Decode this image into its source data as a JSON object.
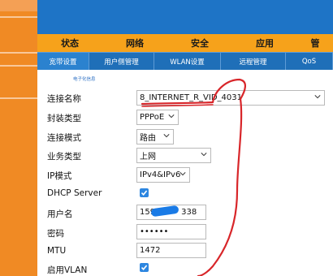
{
  "header": {
    "main_tabs": [
      "状态",
      "网络",
      "安全",
      "应用",
      "管"
    ],
    "sub_tabs": [
      "宽带设置",
      "用户侧管理",
      "WLAN设置",
      "远程管理",
      "QoS"
    ]
  },
  "note": "电子化信息",
  "form": {
    "connection_name": {
      "label": "连接名称",
      "value": "8_INTERNET_R_VID_4031"
    },
    "encapsulation": {
      "label": "封装类型",
      "value": "PPPoE"
    },
    "connection_mode": {
      "label": "连接模式",
      "value": "路由"
    },
    "service_type": {
      "label": "业务类型",
      "value": "上网"
    },
    "ip_mode": {
      "label": "IP模式",
      "value": "IPv4&IPv6"
    },
    "dhcp_server": {
      "label": "DHCP Server",
      "checked": true
    },
    "username": {
      "label": "用户名",
      "value_prefix": "159",
      "value_suffix": "338"
    },
    "password": {
      "label": "密码",
      "value": "••••••"
    },
    "mtu": {
      "label": "MTU",
      "value": "1472"
    },
    "enable_vlan": {
      "label": "启用VLAN",
      "checked": true
    }
  },
  "colors": {
    "sidebar": "#f08a24",
    "header_blue": "#1e74c6",
    "main_nav": "#f6a21b",
    "sub_nav": "#1f6fb8",
    "checkbox": "#2d86e0",
    "annotation_red": "#d8262a"
  }
}
